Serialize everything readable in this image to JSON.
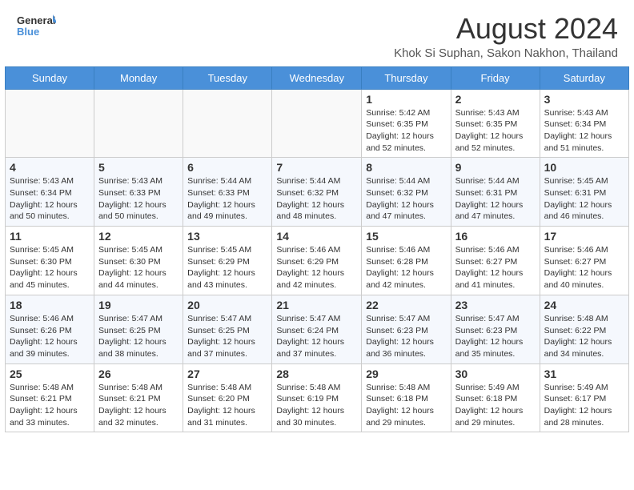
{
  "header": {
    "logo_line1": "General",
    "logo_line2": "Blue",
    "main_title": "August 2024",
    "sub_title": "Khok Si Suphan, Sakon Nakhon, Thailand"
  },
  "days_of_week": [
    "Sunday",
    "Monday",
    "Tuesday",
    "Wednesday",
    "Thursday",
    "Friday",
    "Saturday"
  ],
  "weeks": [
    [
      {
        "num": "",
        "info": ""
      },
      {
        "num": "",
        "info": ""
      },
      {
        "num": "",
        "info": ""
      },
      {
        "num": "",
        "info": ""
      },
      {
        "num": "1",
        "info": "Sunrise: 5:42 AM\nSunset: 6:35 PM\nDaylight: 12 hours\nand 52 minutes."
      },
      {
        "num": "2",
        "info": "Sunrise: 5:43 AM\nSunset: 6:35 PM\nDaylight: 12 hours\nand 52 minutes."
      },
      {
        "num": "3",
        "info": "Sunrise: 5:43 AM\nSunset: 6:34 PM\nDaylight: 12 hours\nand 51 minutes."
      }
    ],
    [
      {
        "num": "4",
        "info": "Sunrise: 5:43 AM\nSunset: 6:34 PM\nDaylight: 12 hours\nand 50 minutes."
      },
      {
        "num": "5",
        "info": "Sunrise: 5:43 AM\nSunset: 6:33 PM\nDaylight: 12 hours\nand 50 minutes."
      },
      {
        "num": "6",
        "info": "Sunrise: 5:44 AM\nSunset: 6:33 PM\nDaylight: 12 hours\nand 49 minutes."
      },
      {
        "num": "7",
        "info": "Sunrise: 5:44 AM\nSunset: 6:32 PM\nDaylight: 12 hours\nand 48 minutes."
      },
      {
        "num": "8",
        "info": "Sunrise: 5:44 AM\nSunset: 6:32 PM\nDaylight: 12 hours\nand 47 minutes."
      },
      {
        "num": "9",
        "info": "Sunrise: 5:44 AM\nSunset: 6:31 PM\nDaylight: 12 hours\nand 47 minutes."
      },
      {
        "num": "10",
        "info": "Sunrise: 5:45 AM\nSunset: 6:31 PM\nDaylight: 12 hours\nand 46 minutes."
      }
    ],
    [
      {
        "num": "11",
        "info": "Sunrise: 5:45 AM\nSunset: 6:30 PM\nDaylight: 12 hours\nand 45 minutes."
      },
      {
        "num": "12",
        "info": "Sunrise: 5:45 AM\nSunset: 6:30 PM\nDaylight: 12 hours\nand 44 minutes."
      },
      {
        "num": "13",
        "info": "Sunrise: 5:45 AM\nSunset: 6:29 PM\nDaylight: 12 hours\nand 43 minutes."
      },
      {
        "num": "14",
        "info": "Sunrise: 5:46 AM\nSunset: 6:29 PM\nDaylight: 12 hours\nand 42 minutes."
      },
      {
        "num": "15",
        "info": "Sunrise: 5:46 AM\nSunset: 6:28 PM\nDaylight: 12 hours\nand 42 minutes."
      },
      {
        "num": "16",
        "info": "Sunrise: 5:46 AM\nSunset: 6:27 PM\nDaylight: 12 hours\nand 41 minutes."
      },
      {
        "num": "17",
        "info": "Sunrise: 5:46 AM\nSunset: 6:27 PM\nDaylight: 12 hours\nand 40 minutes."
      }
    ],
    [
      {
        "num": "18",
        "info": "Sunrise: 5:46 AM\nSunset: 6:26 PM\nDaylight: 12 hours\nand 39 minutes."
      },
      {
        "num": "19",
        "info": "Sunrise: 5:47 AM\nSunset: 6:25 PM\nDaylight: 12 hours\nand 38 minutes."
      },
      {
        "num": "20",
        "info": "Sunrise: 5:47 AM\nSunset: 6:25 PM\nDaylight: 12 hours\nand 37 minutes."
      },
      {
        "num": "21",
        "info": "Sunrise: 5:47 AM\nSunset: 6:24 PM\nDaylight: 12 hours\nand 37 minutes."
      },
      {
        "num": "22",
        "info": "Sunrise: 5:47 AM\nSunset: 6:23 PM\nDaylight: 12 hours\nand 36 minutes."
      },
      {
        "num": "23",
        "info": "Sunrise: 5:47 AM\nSunset: 6:23 PM\nDaylight: 12 hours\nand 35 minutes."
      },
      {
        "num": "24",
        "info": "Sunrise: 5:48 AM\nSunset: 6:22 PM\nDaylight: 12 hours\nand 34 minutes."
      }
    ],
    [
      {
        "num": "25",
        "info": "Sunrise: 5:48 AM\nSunset: 6:21 PM\nDaylight: 12 hours\nand 33 minutes."
      },
      {
        "num": "26",
        "info": "Sunrise: 5:48 AM\nSunset: 6:21 PM\nDaylight: 12 hours\nand 32 minutes."
      },
      {
        "num": "27",
        "info": "Sunrise: 5:48 AM\nSunset: 6:20 PM\nDaylight: 12 hours\nand 31 minutes."
      },
      {
        "num": "28",
        "info": "Sunrise: 5:48 AM\nSunset: 6:19 PM\nDaylight: 12 hours\nand 30 minutes."
      },
      {
        "num": "29",
        "info": "Sunrise: 5:48 AM\nSunset: 6:18 PM\nDaylight: 12 hours\nand 29 minutes."
      },
      {
        "num": "30",
        "info": "Sunrise: 5:49 AM\nSunset: 6:18 PM\nDaylight: 12 hours\nand 29 minutes."
      },
      {
        "num": "31",
        "info": "Sunrise: 5:49 AM\nSunset: 6:17 PM\nDaylight: 12 hours\nand 28 minutes."
      }
    ]
  ]
}
